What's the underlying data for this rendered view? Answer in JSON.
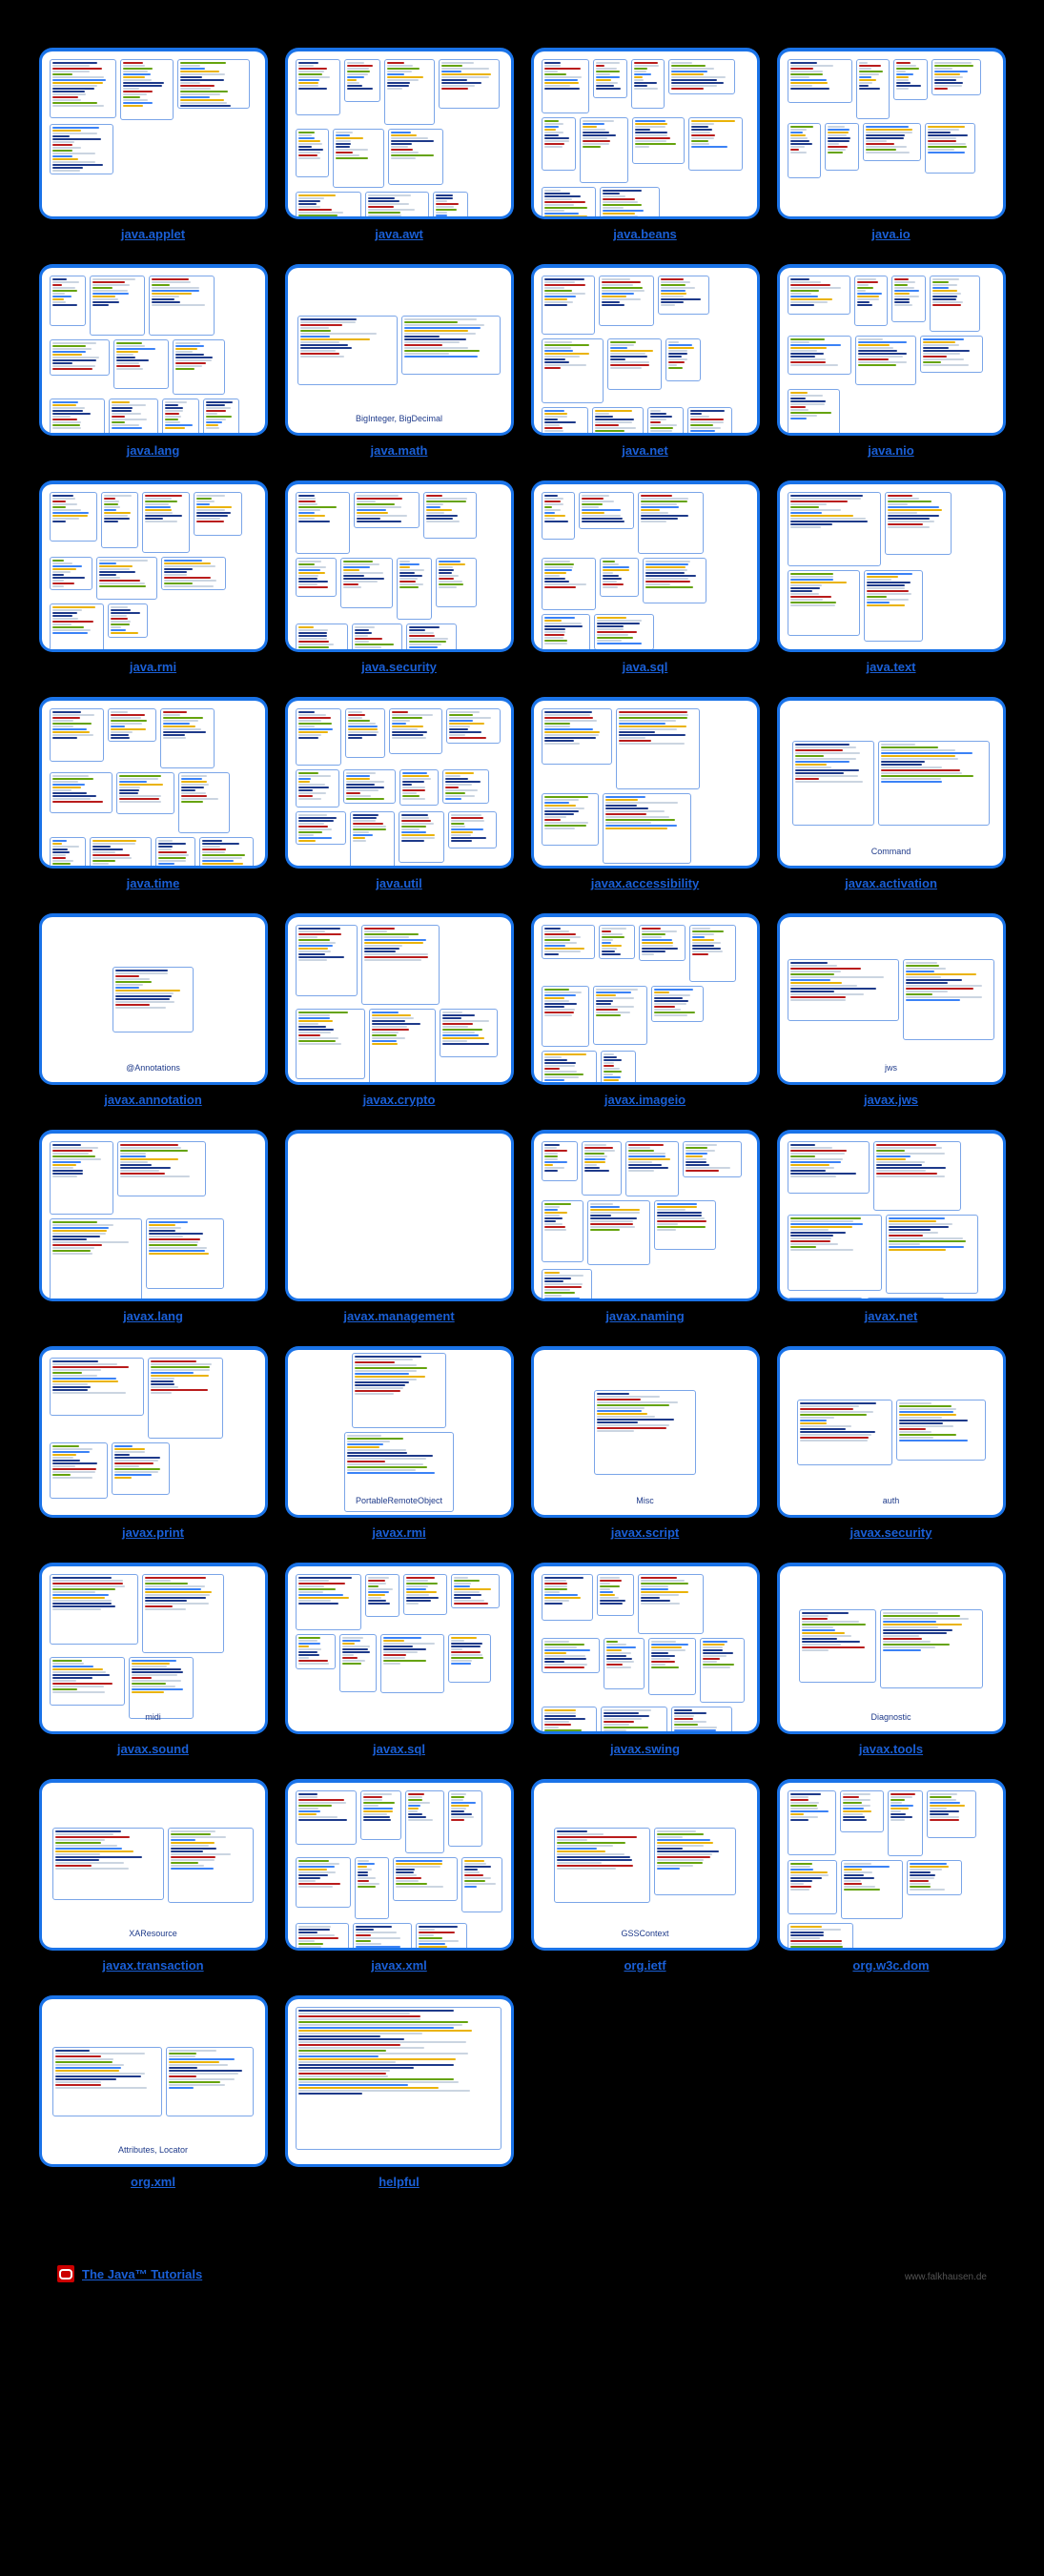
{
  "footer": {
    "tutorials_label": "The Java™ Tutorials",
    "site": "www.falkhausen.de"
  },
  "cards": [
    {
      "label": "java.applet",
      "caption": "",
      "panels": 4,
      "variant": "col"
    },
    {
      "label": "java.awt",
      "caption": "",
      "panels": 16,
      "variant": "many"
    },
    {
      "label": "java.beans",
      "caption": "",
      "panels": 10,
      "variant": "many"
    },
    {
      "label": "java.io",
      "caption": "",
      "panels": 8,
      "variant": "many"
    },
    {
      "label": "java.lang",
      "caption": "",
      "panels": 12,
      "variant": "many"
    },
    {
      "label": "java.math",
      "caption": "BigInteger, BigDecimal",
      "panels": 2,
      "variant": "center"
    },
    {
      "label": "java.net",
      "caption": "",
      "panels": 10,
      "variant": "many"
    },
    {
      "label": "java.nio",
      "caption": "",
      "panels": 8,
      "variant": "many"
    },
    {
      "label": "java.rmi",
      "caption": "",
      "panels": 9,
      "variant": "many"
    },
    {
      "label": "java.security",
      "caption": "",
      "panels": 10,
      "variant": "many"
    },
    {
      "label": "java.sql",
      "caption": "",
      "panels": 8,
      "variant": "many"
    },
    {
      "label": "java.text",
      "caption": "",
      "panels": 4,
      "variant": "few"
    },
    {
      "label": "java.time",
      "caption": "",
      "panels": 10,
      "variant": "many"
    },
    {
      "label": "java.util",
      "caption": "",
      "panels": 12,
      "variant": "many"
    },
    {
      "label": "javax.accessibility",
      "caption": "",
      "panels": 4,
      "variant": "few"
    },
    {
      "label": "javax.activation",
      "caption": "Command",
      "panels": 2,
      "variant": "center"
    },
    {
      "label": "javax.annotation",
      "caption": "@Annotations",
      "panels": 1,
      "variant": "center"
    },
    {
      "label": "javax.crypto",
      "caption": "",
      "panels": 6,
      "variant": "few"
    },
    {
      "label": "javax.imageio",
      "caption": "",
      "panels": 9,
      "variant": "many"
    },
    {
      "label": "javax.jws",
      "caption": "jws",
      "panels": 2,
      "variant": "center"
    },
    {
      "label": "javax.lang",
      "caption": "",
      "panels": 6,
      "variant": "few"
    },
    {
      "label": "javax.management",
      "caption": "",
      "panels": 0,
      "variant": "blank"
    },
    {
      "label": "javax.naming",
      "caption": "",
      "panels": 8,
      "variant": "many"
    },
    {
      "label": "javax.net",
      "caption": "",
      "panels": 6,
      "variant": "few"
    },
    {
      "label": "javax.print",
      "caption": "",
      "panels": 4,
      "variant": "few"
    },
    {
      "label": "javax.rmi",
      "caption": "PortableRemoteObject",
      "panels": 2,
      "variant": "center"
    },
    {
      "label": "javax.script",
      "caption": "Misc",
      "panels": 1,
      "variant": "center"
    },
    {
      "label": "javax.security",
      "caption": "auth",
      "panels": 2,
      "variant": "center"
    },
    {
      "label": "javax.sound",
      "caption": "midi",
      "panels": 4,
      "variant": "few"
    },
    {
      "label": "javax.sql",
      "caption": "",
      "panels": 8,
      "variant": "many"
    },
    {
      "label": "javax.swing",
      "caption": "",
      "panels": 10,
      "variant": "many"
    },
    {
      "label": "javax.tools",
      "caption": "Diagnostic",
      "panels": 2,
      "variant": "center"
    },
    {
      "label": "javax.transaction",
      "caption": "XAResource",
      "panels": 2,
      "variant": "center"
    },
    {
      "label": "javax.xml",
      "caption": "",
      "panels": 12,
      "variant": "many"
    },
    {
      "label": "org.ietf",
      "caption": "GSSContext",
      "panels": 2,
      "variant": "center"
    },
    {
      "label": "org.w3c.dom",
      "caption": "",
      "panels": 8,
      "variant": "many"
    },
    {
      "label": "org.xml",
      "caption": "Attributes, Locator",
      "panels": 2,
      "variant": "center"
    },
    {
      "label": "helpful",
      "caption": "",
      "panels": 1,
      "variant": "wide"
    }
  ]
}
